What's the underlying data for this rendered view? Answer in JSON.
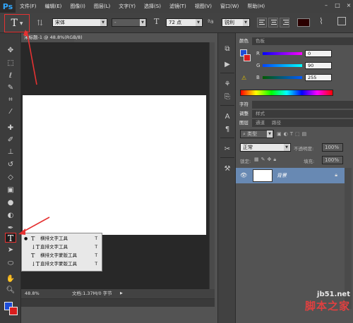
{
  "app": {
    "logo": "Ps"
  },
  "menu": [
    "文件(F)",
    "编辑(E)",
    "图像(I)",
    "图层(L)",
    "文字(Y)",
    "选择(S)",
    "滤镜(T)",
    "视图(V)",
    "窗口(W)",
    "帮助(H)"
  ],
  "window_controls": [
    "–",
    "□",
    "×"
  ],
  "options_bar": {
    "tool_icon": "T",
    "font_family": "宋体",
    "font_style": "-",
    "font_size": "72 点",
    "anti_alias": "锐利",
    "color": "#2a0000"
  },
  "document": {
    "tab_title": "未标题-1 @ 48.8%(RGB/8)",
    "zoom": "48.8%",
    "doc_info": "文档:1.37M/0 字节"
  },
  "flyout": [
    {
      "label": "横排文字工具",
      "key": "T",
      "selected": true
    },
    {
      "label": "直排文字工具",
      "key": "T",
      "selected": false
    },
    {
      "label": "横排文字蒙版工具",
      "key": "T",
      "selected": false
    },
    {
      "label": "直排文字蒙版工具",
      "key": "T",
      "selected": false
    }
  ],
  "color_panel": {
    "tabs": [
      "颜色",
      "色板"
    ],
    "R": "0",
    "G": "90",
    "B": "255"
  },
  "char_panel": {
    "tab": "字符"
  },
  "adjust_panel": {
    "tabs": [
      "调整",
      "样式"
    ]
  },
  "layers_panel": {
    "tabs": [
      "图层",
      "通道",
      "路径"
    ],
    "filter": "类型",
    "blend_mode": "正常",
    "opacity_label": "不透明度:",
    "opacity_value": "100%",
    "lock_label": "锁定:",
    "fill_label": "填充:",
    "fill_value": "100%",
    "layer_name": "背景"
  },
  "watermark": {
    "line1": "jb51.net",
    "line2": "脚本之家"
  },
  "colors": {
    "foreground": "#1d4dd8",
    "background": "#d81d1d",
    "accent_red": "#e53232"
  }
}
